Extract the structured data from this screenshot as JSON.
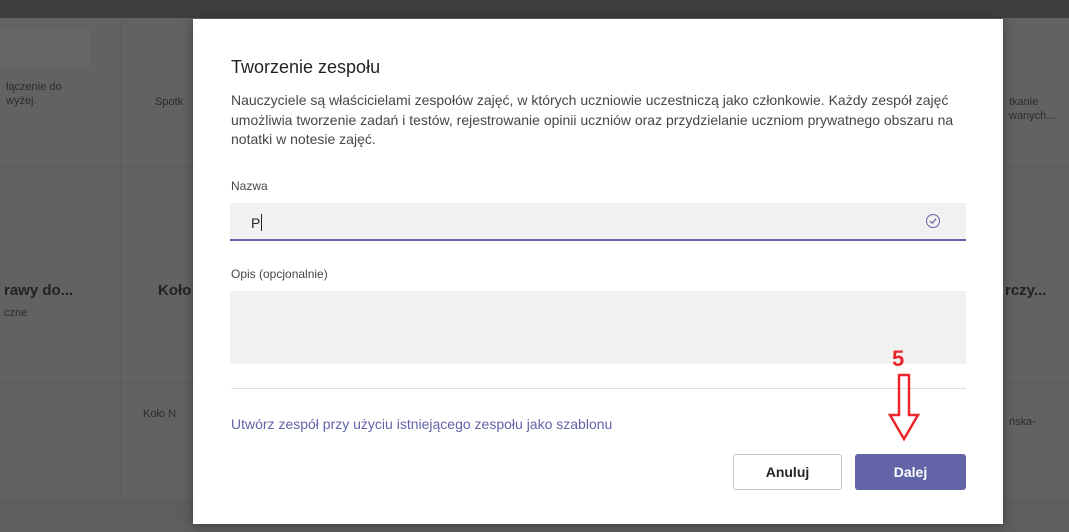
{
  "background": {
    "left_text_1": "łączenie do",
    "left_text_2": "wyżej.",
    "col2_text": "Spotk",
    "right_text_1": "tkanie",
    "right_text_2": "wanych...",
    "left_title": "rawy do...",
    "left_sub": "czne",
    "col2_title": "Koło",
    "right_title": "rczy...",
    "col2_bottom": "Koło N",
    "right_bottom": "ńska-"
  },
  "dialog": {
    "title": "Tworzenie zespołu",
    "description": "Nauczyciele są właścicielami zespołów zajęć, w których uczniowie uczestniczą jako członkowie. Każdy zespół zajęć umożliwia tworzenie zadań i testów, rejestrowanie opinii uczniów oraz przydzielanie uczniom prywatnego obszaru na notatki w notesie zajęć.",
    "name_label": "Nazwa",
    "name_value": "P",
    "desc_label": "Opis (opcjonalnie)",
    "desc_value": "",
    "template_link": "Utwórz zespół przy użyciu istniejącego zespołu jako szablonu",
    "cancel_label": "Anuluj",
    "next_label": "Dalej"
  },
  "annotation": {
    "step_number": "5",
    "color": "#e8262b"
  },
  "colors": {
    "accent": "#6264a7"
  }
}
